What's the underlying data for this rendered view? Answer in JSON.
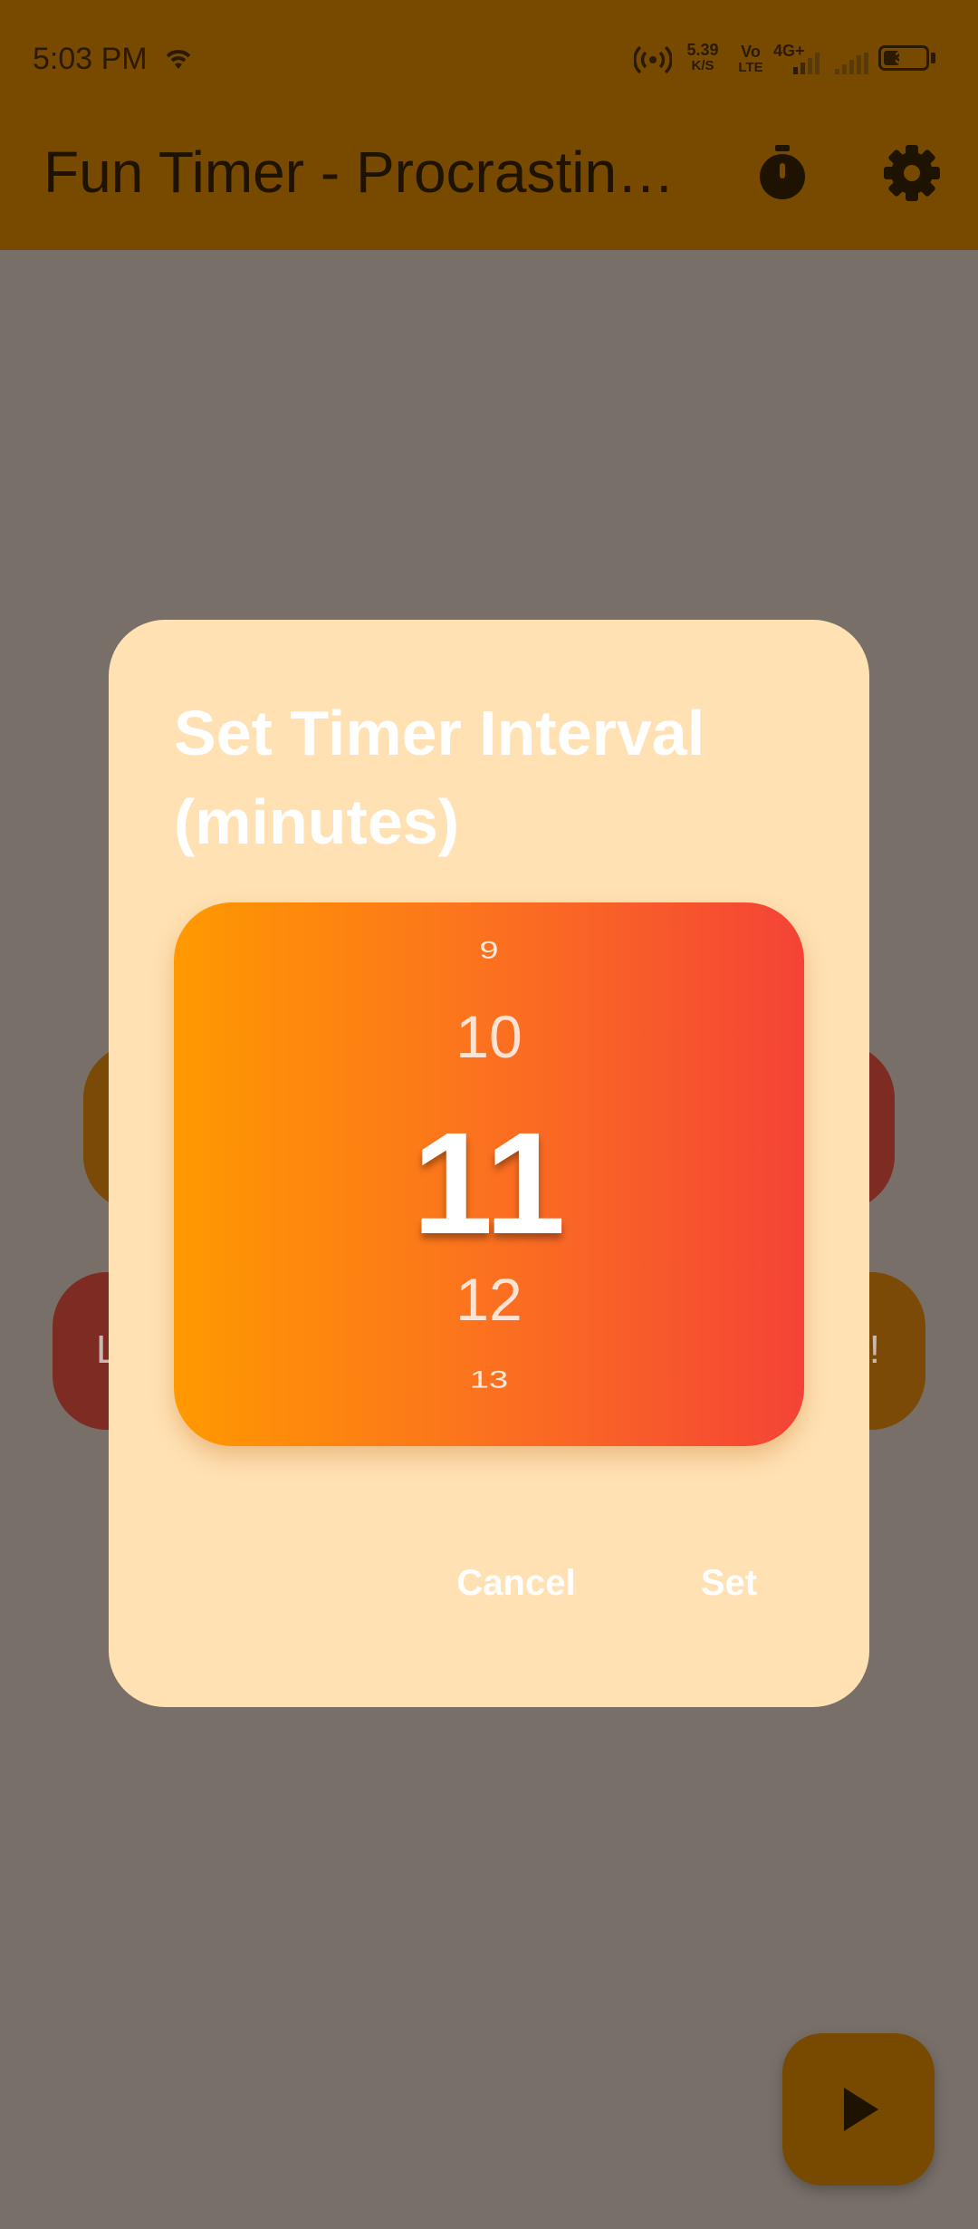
{
  "status_bar": {
    "time": "5:03 PM",
    "speed_value": "5.39",
    "speed_unit": "K/S",
    "volte_top": "Vo",
    "volte_bottom": "LTE",
    "network": "4G+",
    "battery": "39",
    "battery_level_percent": 39
  },
  "app_bar": {
    "title": "Fun Timer - Procrastin…",
    "timer_icon": "stopwatch-icon",
    "settings_icon": "gear-icon"
  },
  "background_buttons": {
    "left_label": "L",
    "right_label": "!"
  },
  "dialog": {
    "title": "Set Timer Interval (minutes)",
    "picker_values": {
      "prev2": "9",
      "prev1": "10",
      "selected": "11",
      "next1": "12",
      "next2": "13"
    },
    "cancel_label": "Cancel",
    "set_label": "Set"
  },
  "fab": {
    "icon": "play-icon"
  },
  "colors": {
    "app_bar": "#774a00",
    "scrim_background": "#786f69",
    "dialog_background": "#ffe1b3",
    "picker_gradient_start": "#ff9900",
    "picker_gradient_end": "#f44336"
  }
}
